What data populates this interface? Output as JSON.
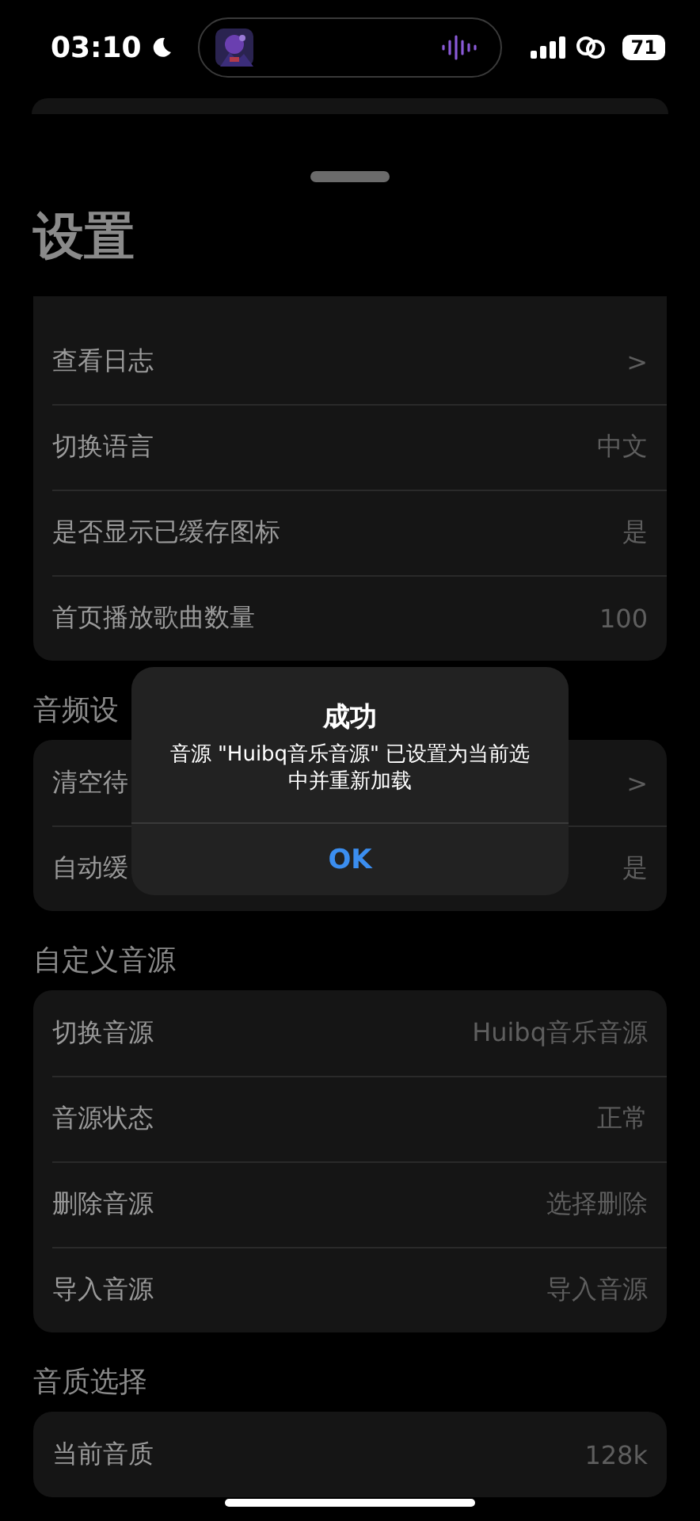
{
  "status_bar": {
    "time": "03:10",
    "battery": "71"
  },
  "title": "设置",
  "groups": [
    {
      "rows": [
        {
          "label": "查看日志",
          "value": ">"
        },
        {
          "label": "切换语言",
          "value": "中文"
        },
        {
          "label": "是否显示已缓存图标",
          "value": "是"
        },
        {
          "label": "首页播放歌曲数量",
          "value": "100"
        }
      ]
    },
    {
      "header": "音频设",
      "rows": [
        {
          "label": "清空待",
          "value": ">"
        },
        {
          "label": "自动缓",
          "value": "是"
        }
      ]
    },
    {
      "header": "自定义音源",
      "rows": [
        {
          "label": "切换音源",
          "value": "Huibq音乐音源"
        },
        {
          "label": "音源状态",
          "value": "正常"
        },
        {
          "label": "删除音源",
          "value": "选择删除"
        },
        {
          "label": "导入音源",
          "value": "导入音源"
        }
      ]
    },
    {
      "header": "音质选择",
      "rows": [
        {
          "label": "当前音质",
          "value": "128k"
        }
      ]
    }
  ],
  "dialog": {
    "title": "成功",
    "message": "音源 \"Huibq音乐音源\" 已设置为当前选中并重新加载",
    "button": "OK"
  }
}
